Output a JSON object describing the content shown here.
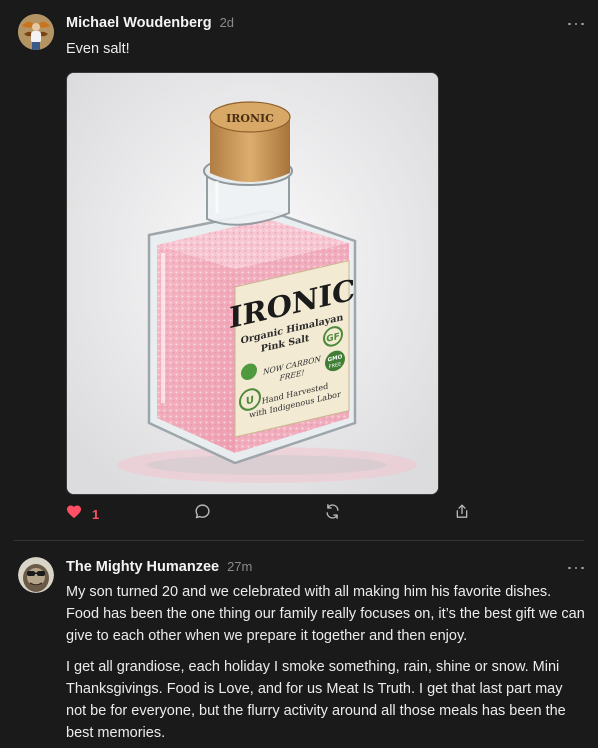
{
  "posts": [
    {
      "author": "Michael Woudenberg",
      "time": "2d",
      "text": "Even salt!",
      "media": {
        "cork_label": "IRONIC",
        "brand": "IRONIC",
        "product_line1": "Organic Himalayan",
        "product_line2": "Pink Salt",
        "badge_gf": "GF",
        "badge_gmo": "GMO",
        "badge_gmo_sub": "FREE",
        "carbon_line1": "NOW CARBON",
        "carbon_line2": "FREE!",
        "harvest_line1": "Hand Harvested",
        "harvest_line2": "with Indigenous Labor",
        "badge_u": "U"
      },
      "likes": "1",
      "like_color": "#ff4f64",
      "icons": [
        "heart-icon",
        "reply-icon",
        "repost-icon",
        "share-icon"
      ]
    },
    {
      "author": "The Mighty Humanzee",
      "time": "27m",
      "paragraphs": [
        "My son turned 20 and we celebrated with all making him his favorite dishes. Food has been the one thing our family really focuses on, it’s the best gift we can give to each other when we prepare it together and then enjoy.",
        "I get all grandiose, each holiday I smoke something, rain, shine or snow. Mini Thanksgivings. Food is Love, and for us Meat Is Truth. I get that last part may not be for everyone, but the flurry activity around all those meals has been the best memories."
      ]
    }
  ]
}
